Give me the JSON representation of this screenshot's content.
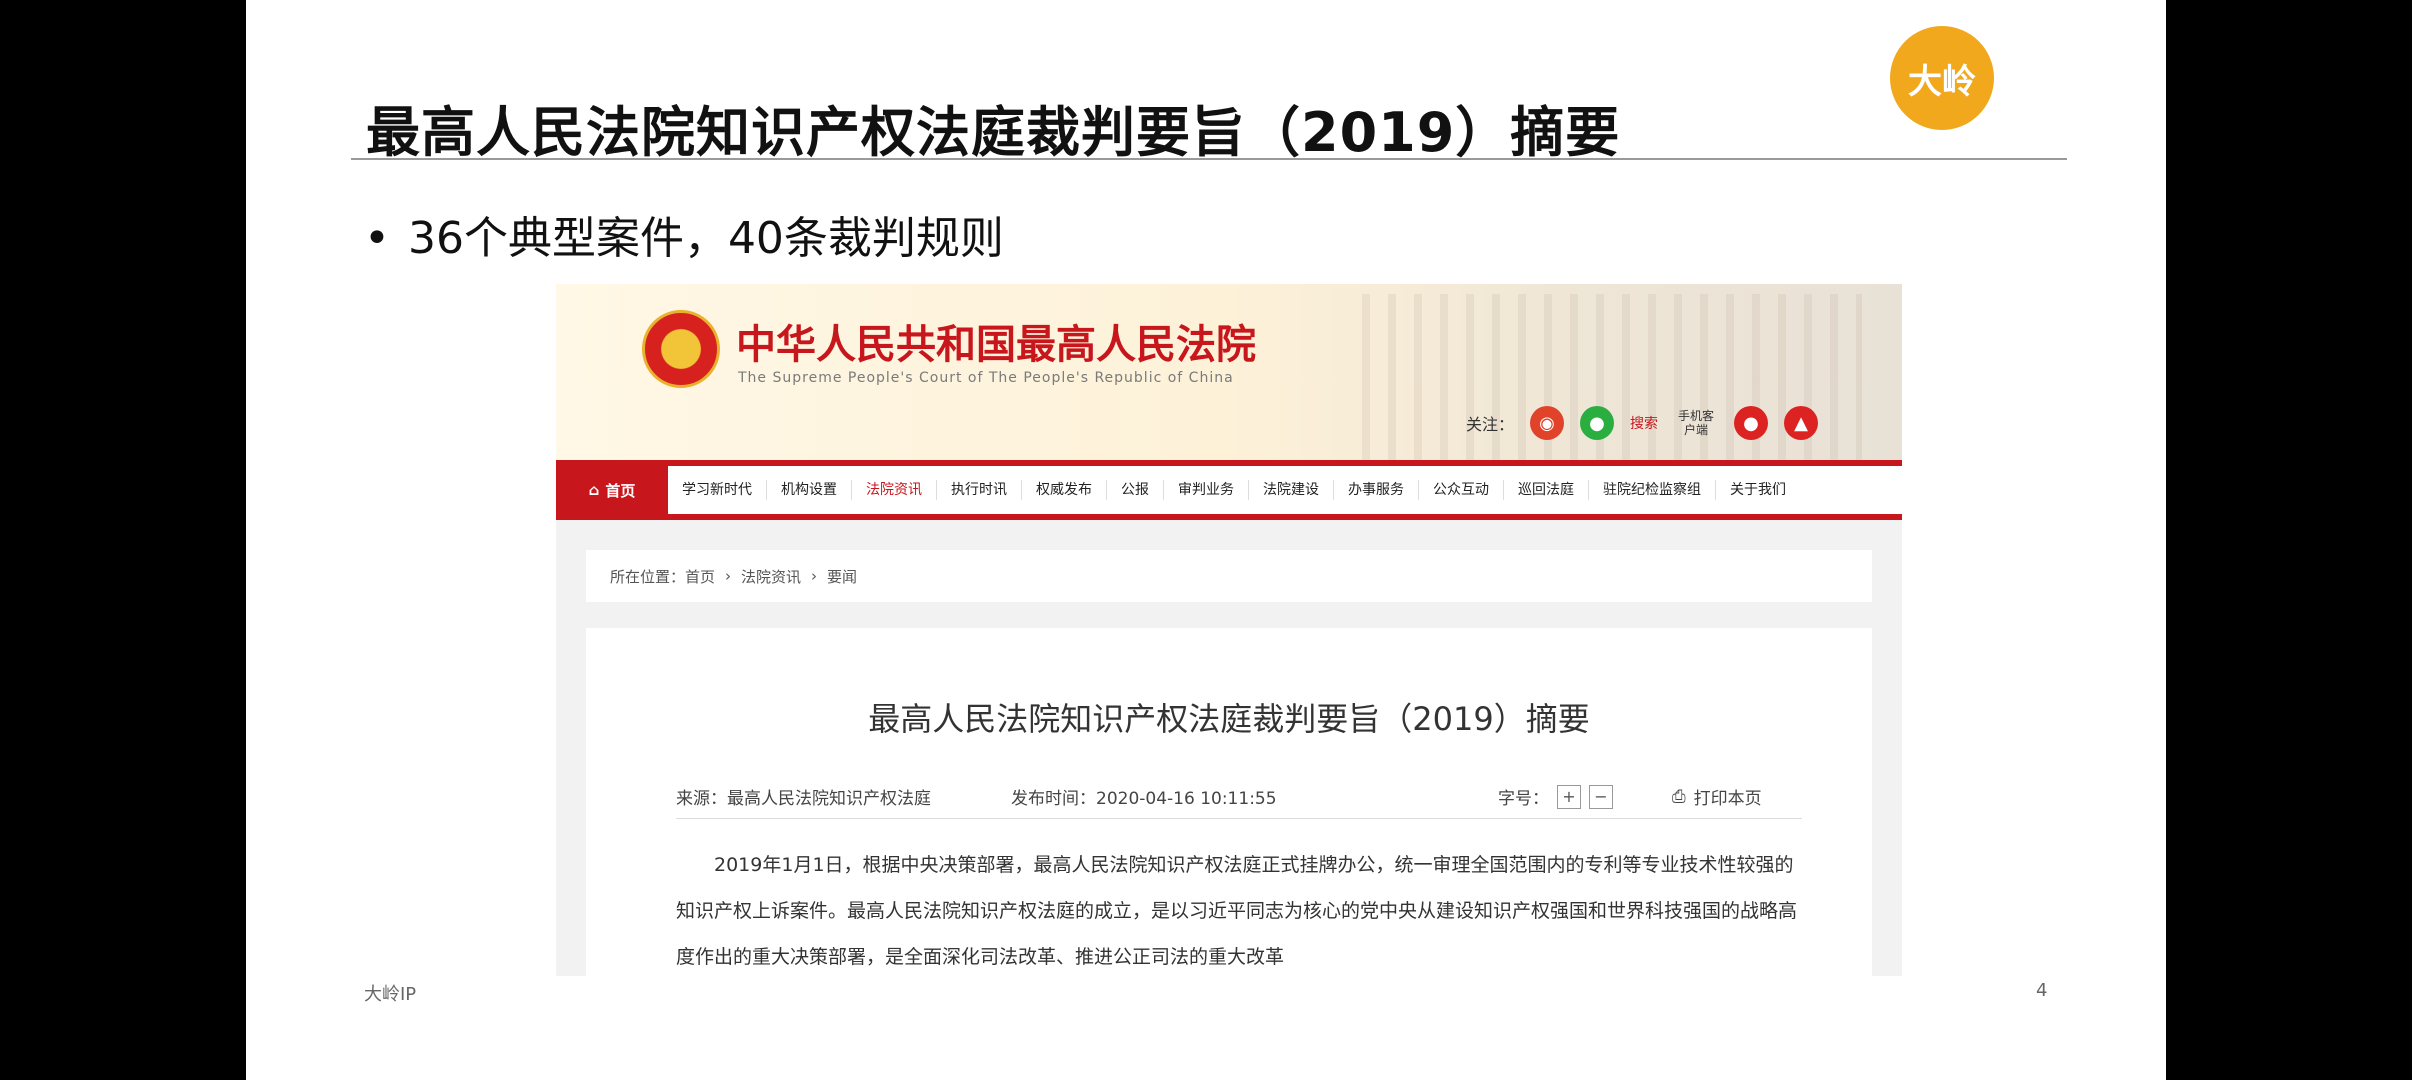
{
  "slide": {
    "title": "最高人民法院知识产权法庭裁判要旨（2019）摘要",
    "logo_text": "大岭",
    "bullet": "36个典型案件，40条裁判规则",
    "footer_left": "大岭IP",
    "page_number": "4"
  },
  "website": {
    "court_name_cn": "中华人民共和国最高人民法院",
    "court_name_en": "The Supreme People's Court of The People's Republic of China",
    "follow_label": "关注：",
    "search_label": "搜索",
    "client_label": "手机客户端",
    "nav": {
      "home": "首页",
      "items": [
        "学习新时代",
        "机构设置",
        "法院资讯",
        "执行时讯",
        "权威发布",
        "公报",
        "审判业务",
        "法院建设",
        "办事服务",
        "公众互动",
        "巡回法庭",
        "驻院纪检监察组",
        "关于我们"
      ],
      "active_index": 2
    },
    "breadcrumb": {
      "prefix": "所在位置：",
      "items": [
        "首页",
        "法院资讯",
        "要闻"
      ]
    },
    "article": {
      "title": "最高人民法院知识产权法庭裁判要旨（2019）摘要",
      "source": "来源：最高人民法院知识产权法庭",
      "published": "发布时间：2020-04-16 10:11:55",
      "font_size_label": "字号：",
      "print_label": "打印本页",
      "paragraph": "　　2019年1月1日，根据中央决策部署，最高人民法院知识产权法庭正式挂牌办公，统一审理全国范围内的专利等专业技术性较强的知识产权上诉案件。最高人民法院知识产权法庭的成立，是以习近平同志为核心的党中央从建设知识产权强国和世界科技强国的战略高度作出的重大决策部署，是全面深化司法改革、推进公正司法的重大改革"
    }
  }
}
